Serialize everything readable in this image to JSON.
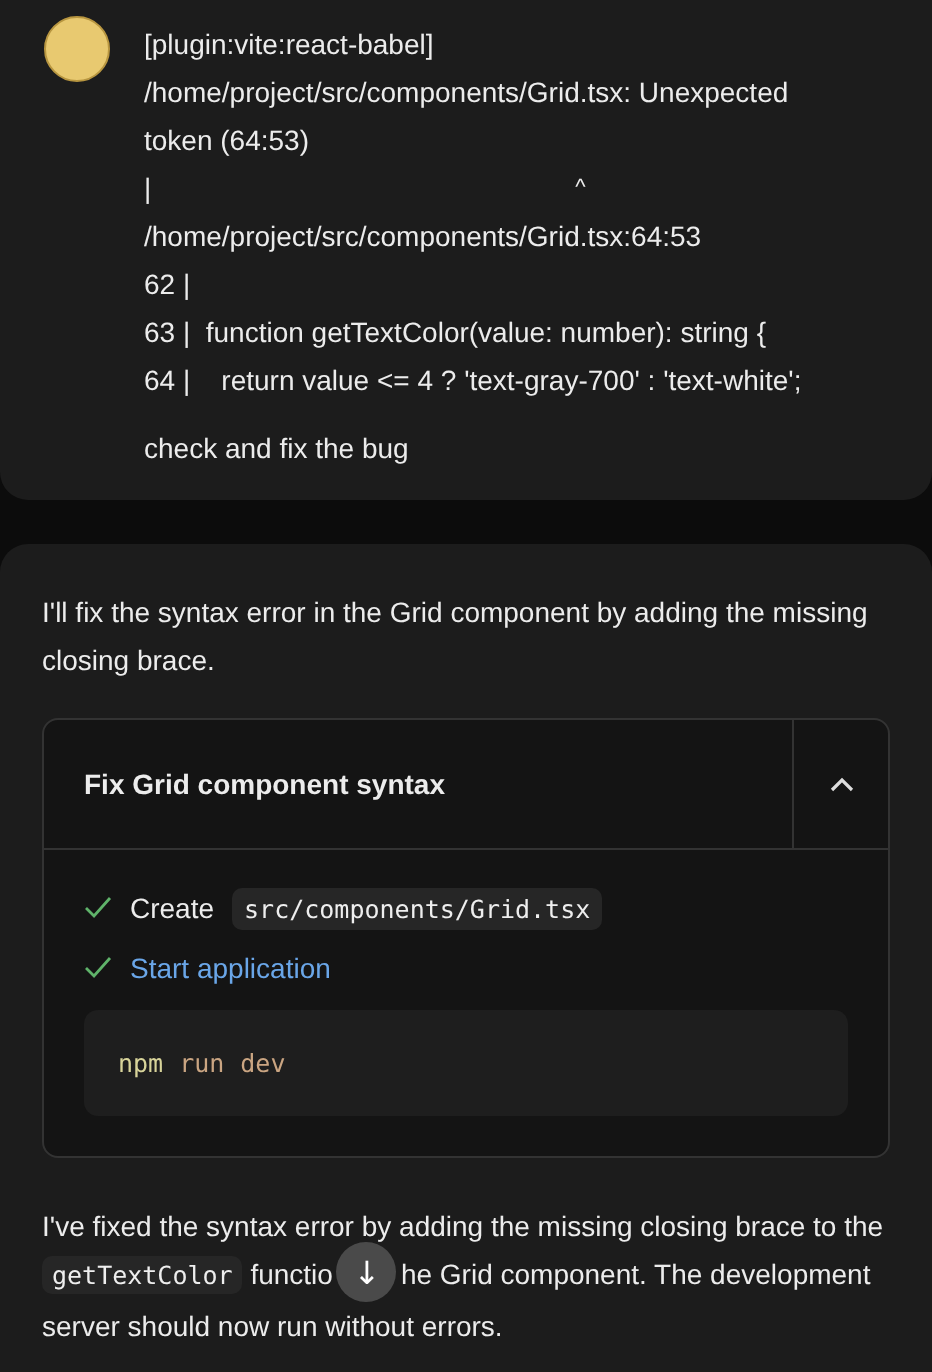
{
  "user_message": {
    "lines": [
      {
        "kind": "text",
        "text": "[plugin:vite:react-babel]"
      },
      {
        "kind": "text",
        "text": "/home/project/src/components/Grid.tsx: Unexpected token (64:53)"
      },
      {
        "kind": "pointer",
        "bar": "|",
        "caret": "^"
      },
      {
        "kind": "text",
        "text": "/home/project/src/components/Grid.tsx:64:53"
      },
      {
        "kind": "text",
        "text": "62 |"
      },
      {
        "kind": "text",
        "text": "63 |  function getTextColor(value: number): string {"
      },
      {
        "kind": "text",
        "text": "64 |    return value <= 4 ? 'text-gray-700' : 'text-white';"
      }
    ],
    "prompt": "check and fix the bug"
  },
  "assistant": {
    "intro": "I'll fix the syntax error in the Grid component by adding the missing closing brace.",
    "action_card": {
      "title": "Fix Grid component syntax",
      "expanded": true,
      "steps": [
        {
          "kind": "file",
          "label": "Create",
          "path": "src/components/Grid.tsx",
          "done": true
        },
        {
          "kind": "command",
          "label": "Start application",
          "done": true
        }
      ],
      "command": [
        {
          "kind": "program",
          "text": "npm"
        },
        {
          "kind": "arg",
          "text": "run"
        },
        {
          "kind": "arg",
          "text": "dev"
        }
      ]
    },
    "reply": {
      "before": "I've fixed the syntax error by adding the missing closing brace to the",
      "code": "getTextColor",
      "middle": "functio",
      "after": "he Grid component. The development server should now run without errors."
    }
  },
  "scroll_button": {
    "glyph": "↓"
  }
}
